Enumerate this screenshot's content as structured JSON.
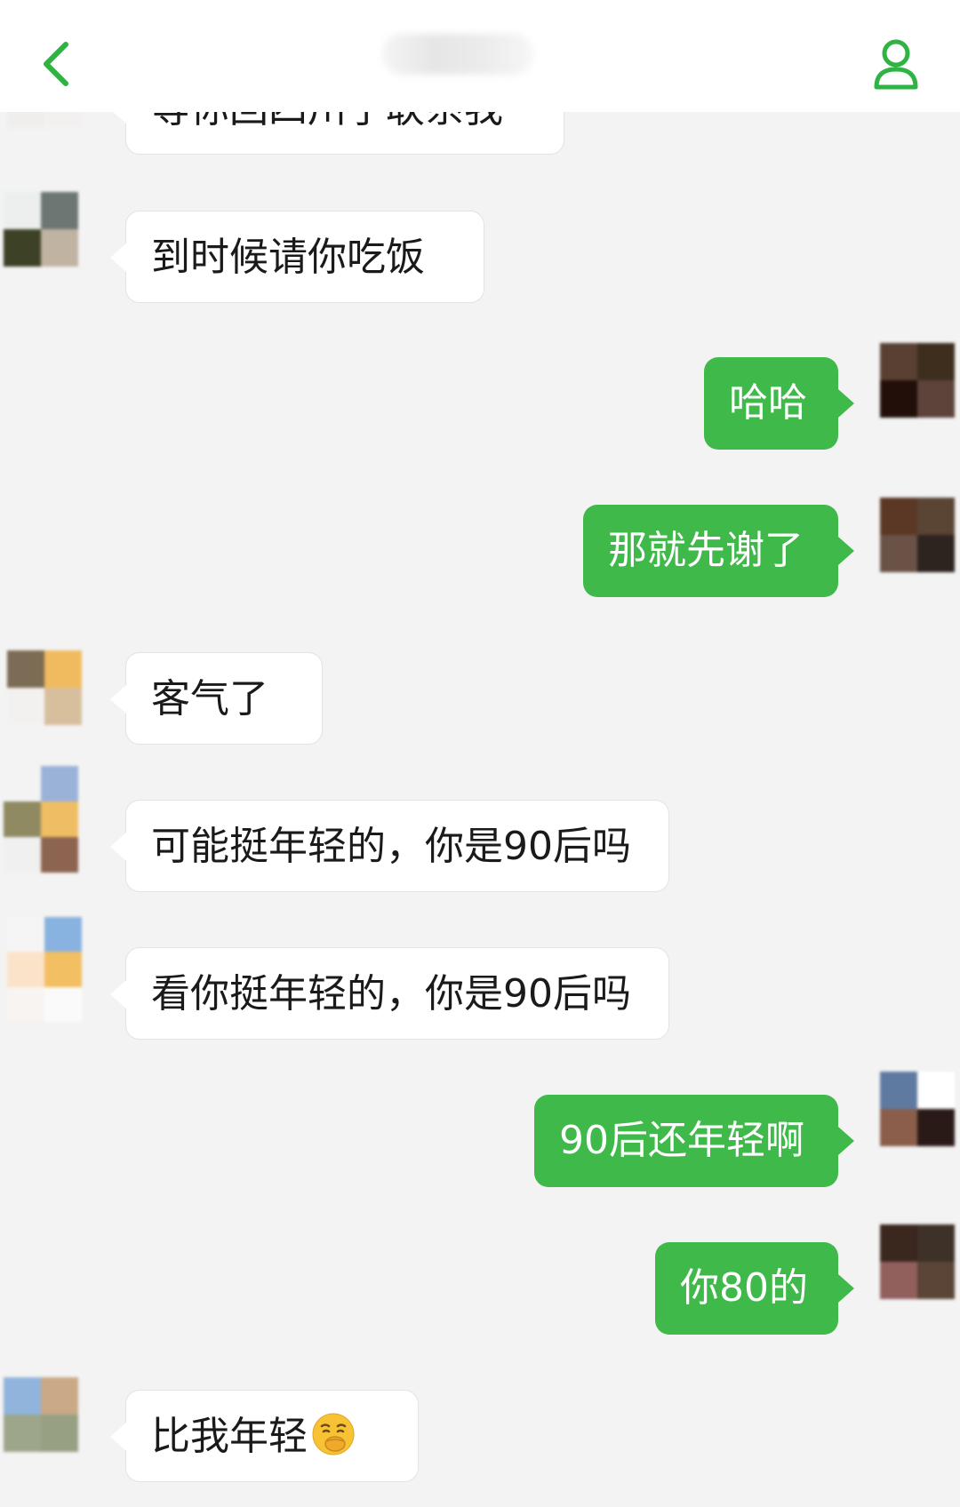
{
  "header": {
    "title": "",
    "back_icon": "chevron-left-icon",
    "profile_icon": "person-icon",
    "accent": "#2fb342"
  },
  "colors": {
    "background": "#f3f3f3",
    "bubble_in": "#ffffff",
    "bubble_out": "#3fba4a",
    "text_in": "#1a1a1a",
    "text_out": "#ffffff"
  },
  "messages": [
    {
      "side": "in",
      "text": "等你回四川了联系我",
      "partial": true
    },
    {
      "side": "in",
      "text": "到时候请你吃饭"
    },
    {
      "side": "out",
      "text": "哈哈"
    },
    {
      "side": "out",
      "text": "那就先谢了"
    },
    {
      "side": "in",
      "text": "客气了"
    },
    {
      "side": "in",
      "text": "可能挺年轻的，你是90后吗"
    },
    {
      "side": "in",
      "text": "看你挺年轻的，你是90后吗"
    },
    {
      "side": "out",
      "text": "90后还年轻啊"
    },
    {
      "side": "out",
      "text": "你80的"
    },
    {
      "side": "in",
      "text": "比我年轻",
      "emoji": "smirk-hand-over-mouth-emoji"
    }
  ]
}
